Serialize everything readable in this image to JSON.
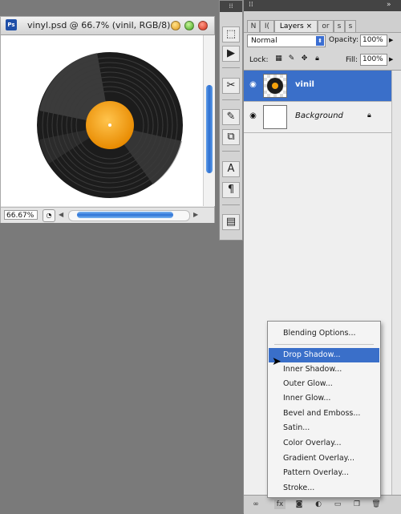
{
  "document": {
    "title": "vinyl.psd @ 66.7% (vinil, RGB/8)",
    "app_icon_label": "Ps",
    "zoom": "66.67%",
    "record": {
      "label_color": "#f5a20c",
      "vinyl_color": "#1e1e1e"
    }
  },
  "layers_panel": {
    "tabs": [
      {
        "label": "N"
      },
      {
        "label": "I("
      },
      {
        "label": "Layers"
      },
      {
        "label": "or"
      },
      {
        "label": "s"
      },
      {
        "label": "s"
      }
    ],
    "active_tab_close": "×",
    "blend_mode": "Normal",
    "opacity_label": "Opacity:",
    "opacity_value": "100%",
    "lock_label": "Lock:",
    "fill_label": "Fill:",
    "fill_value": "100%",
    "layers": [
      {
        "name": "vinil",
        "selected": true,
        "visible": true
      },
      {
        "name": "Background",
        "selected": false,
        "visible": true,
        "locked": true
      }
    ]
  },
  "context_menu": {
    "items": [
      {
        "label": "Blending Options..."
      },
      {
        "label": "Drop Shadow...",
        "highlighted": true
      },
      {
        "label": "Inner Shadow..."
      },
      {
        "label": "Outer Glow..."
      },
      {
        "label": "Inner Glow..."
      },
      {
        "label": "Bevel and Emboss..."
      },
      {
        "label": "Satin..."
      },
      {
        "label": "Color Overlay..."
      },
      {
        "label": "Gradient Overlay..."
      },
      {
        "label": "Pattern Overlay..."
      },
      {
        "label": "Stroke..."
      }
    ]
  },
  "colors": {
    "selection_blue": "#3a6fc9",
    "workspace_gray": "#7a7a7a"
  }
}
